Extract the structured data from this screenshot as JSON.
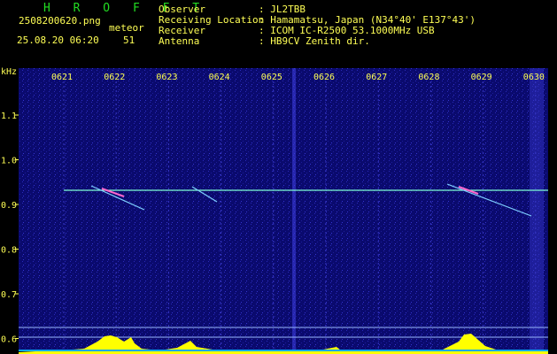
{
  "app": {
    "title": "H R O F F T"
  },
  "info": {
    "filename": "2508200620.png",
    "datetime": "25.08.20 06:20",
    "count_label": "meteor",
    "count_value": "51"
  },
  "station": {
    "labels": [
      "Observer",
      "Receiving Location",
      "Receiver",
      "Antenna"
    ],
    "values": [
      ": JL2TBB",
      ": Hamamatsu, Japan (N34°40' E137°43')",
      ": ICOM IC-R2500 53.1000MHz USB",
      ": HB9CV Zenith dir."
    ]
  },
  "axes": {
    "y_unit": "kHz",
    "x_ticks": [
      "0621",
      "0622",
      "0623",
      "0624",
      "0625",
      "0626",
      "0627",
      "0628",
      "0629",
      "0630"
    ],
    "y_ticks": [
      "1.1",
      "1.0",
      "0.9",
      "0.8",
      "0.7",
      "0.6"
    ]
  },
  "colors": {
    "background": "#000000",
    "spectrogram_bg": "#0a0a6e",
    "text": "#ffff55",
    "title": "#22dd22",
    "carrier": "#7fffd4",
    "meteor": "#ff66cc",
    "histogram": "#ffff00",
    "baseline": "#00aaff"
  }
}
